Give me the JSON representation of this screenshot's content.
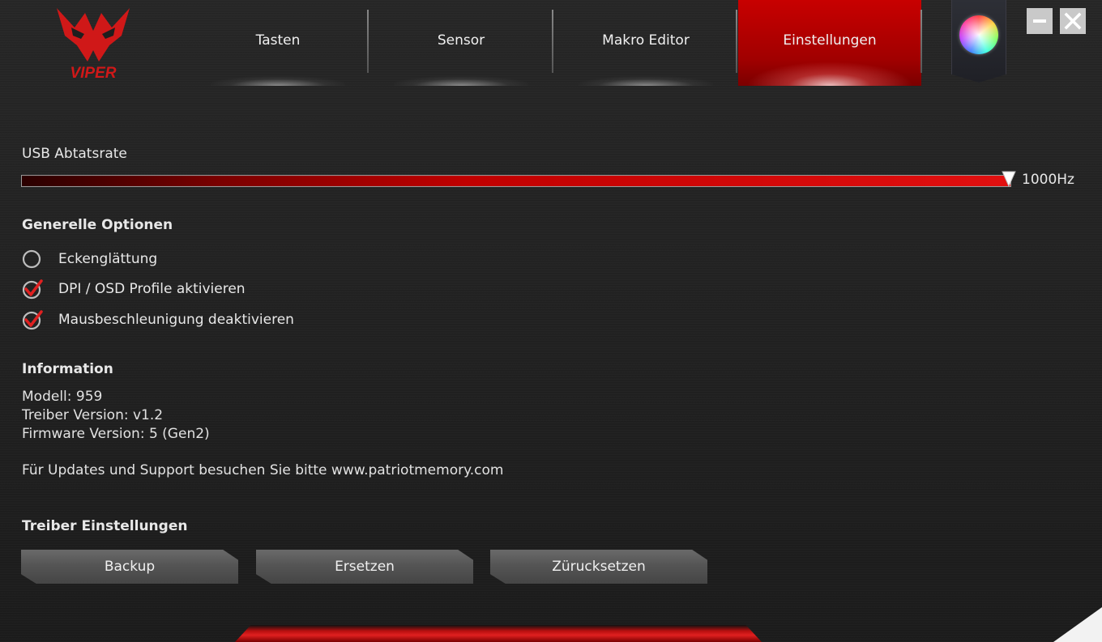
{
  "app": {
    "logo_text": "VIPER"
  },
  "nav": {
    "tabs": [
      {
        "label": "Tasten",
        "active": false
      },
      {
        "label": "Sensor",
        "active": false
      },
      {
        "label": "Makro Editor",
        "active": false
      },
      {
        "label": "Einstellungen",
        "active": true
      }
    ],
    "color_button_icon": "color-wheel-icon"
  },
  "window": {
    "minimize_icon": "minimize-icon",
    "close_icon": "close-icon"
  },
  "usb": {
    "label": "USB Abtatsrate",
    "value_text": "1000Hz",
    "level": 1.0
  },
  "general": {
    "heading": "Generelle Optionen",
    "options": [
      {
        "label": "Eckenglättung",
        "checked": false
      },
      {
        "label": "DPI / OSD Profile aktivieren",
        "checked": true
      },
      {
        "label": "Mausbeschleunigung deaktivieren",
        "checked": true
      }
    ]
  },
  "information": {
    "heading": "Information",
    "model": "Modell: 959",
    "driver": "Treiber Version: v1.2",
    "firmware": "Firmware Version: 5 (Gen2)",
    "support": "Für Updates und Support besuchen Sie bitte www.patriotmemory.com"
  },
  "driver_settings": {
    "heading": "Treiber Einstellungen",
    "backup_label": "Backup",
    "replace_label": "Ersetzen",
    "reset_label": "Zürucksetzen"
  },
  "colors": {
    "accent": "#c80000",
    "background": "#222222",
    "check": "#e02020"
  }
}
